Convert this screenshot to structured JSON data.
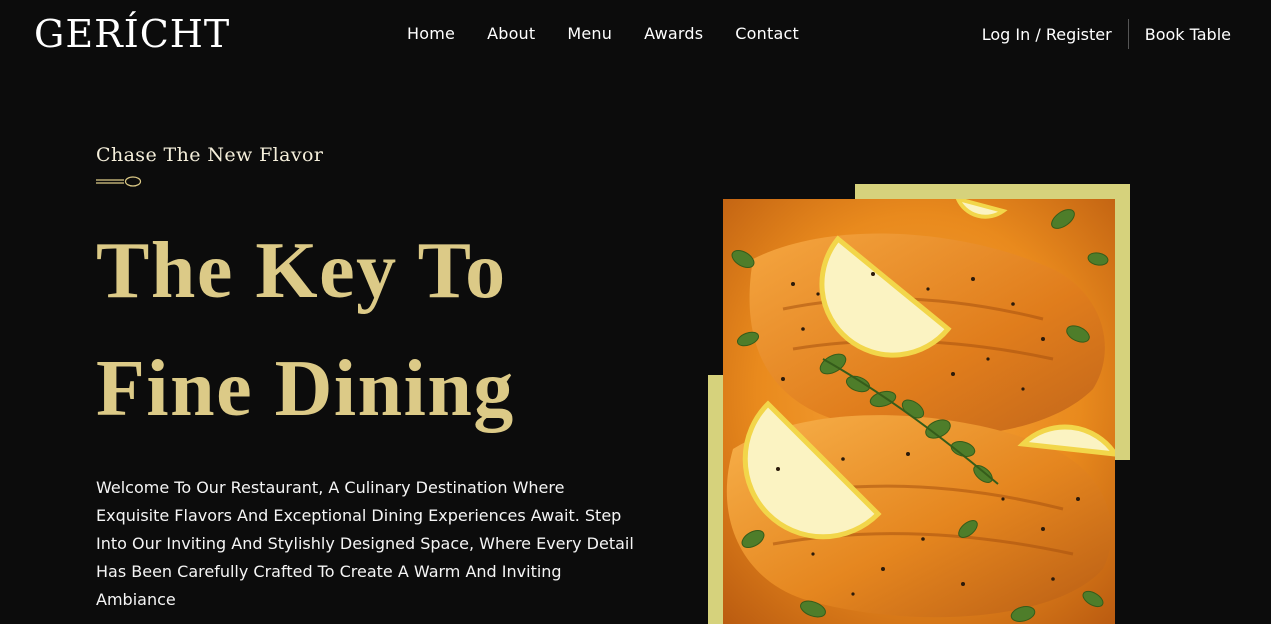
{
  "brand": {
    "logo_text": "GERÍCHT"
  },
  "nav": {
    "links": [
      "Home",
      "About",
      "Menu",
      "Awards",
      "Contact"
    ],
    "login_label": "Log In / Register",
    "book_label": "Book Table"
  },
  "hero": {
    "subtitle": "Chase The New Flavor",
    "headline_line1": "The Key To",
    "headline_line2": "Fine Dining",
    "intro": "Welcome To Our Restaurant, A Culinary Destination Where Exquisite Flavors And Exceptional Dining Experiences Await. Step Into Our Inviting And Stylishly Designed Space, Where Every Detail Has Been Carefully Crafted To Create A Warm And Inviting Ambiance"
  },
  "colors": {
    "background": "#0c0c0c",
    "accent_gold": "#dcca87",
    "frame_yellow": "#d6d27c",
    "text": "#ffffff"
  },
  "icons": {
    "divider": "spoon-icon"
  }
}
